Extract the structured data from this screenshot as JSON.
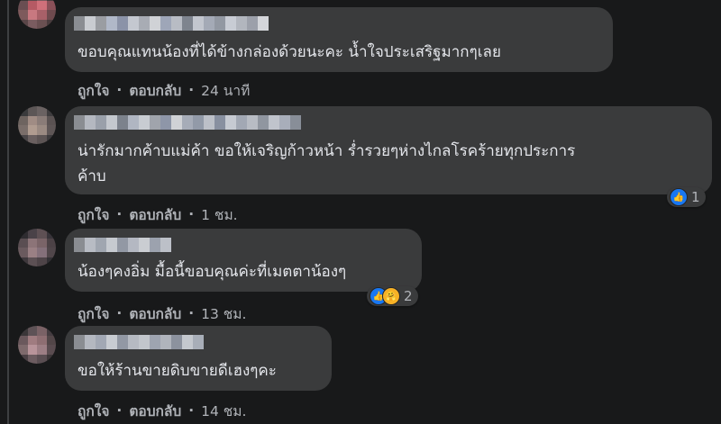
{
  "colors": {
    "background": "#18191a",
    "bubble": "#3a3b3c",
    "text": "#e4e6eb",
    "meta": "#b0b3b8",
    "like_blue": "#1877f2",
    "care_yellow": "#f7b125"
  },
  "actions": {
    "like_label": "ถูกใจ",
    "reply_label": "ตอบกลับ",
    "separator": "·"
  },
  "comments": [
    {
      "text": "ขอบคุณแทนน้องที่ได้ข้างกล่องด้วยนะคะ น้ำใจประเสริฐมากๆเลย",
      "time": "24 นาที",
      "reaction_count": ""
    },
    {
      "text": "น่ารักมากค้าบแม่ค้า ขอให้เจริญก้าวหน้า ร่ำรวยๆห่างไกลโรคร้ายทุกประการ\nค้าบ",
      "time": "1 ชม.",
      "reaction_icons": [
        "like-icon"
      ],
      "reaction_count": "1"
    },
    {
      "text": "น้องๆคงอิ่ม มื้อนี้ขอบคุณค่ะที่เมตตาน้องๆ",
      "time": "13 ชม.",
      "reaction_icons": [
        "like-icon",
        "care-icon"
      ],
      "reaction_count": "2"
    },
    {
      "text": "ขอให้ร้านขายดิบขายดีเฮงๆคะ",
      "time": "14 ชม.",
      "reaction_count": ""
    }
  ]
}
